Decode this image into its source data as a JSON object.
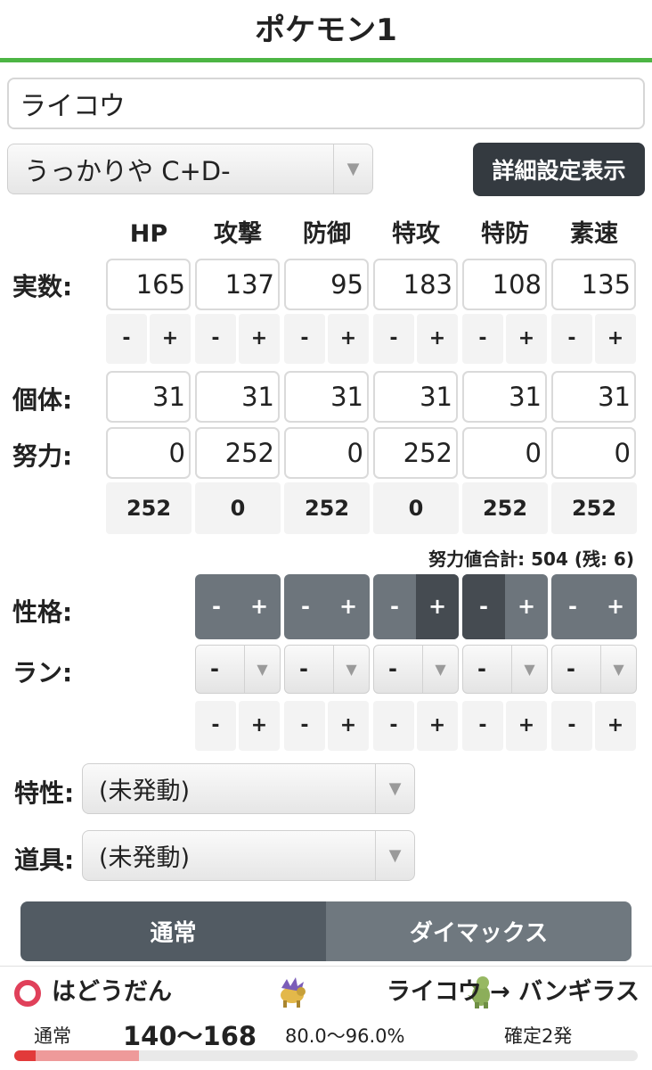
{
  "header": {
    "title": "ポケモン1"
  },
  "pokemon": {
    "name": "ライコウ"
  },
  "nature_select": {
    "value": "うっかりや C+D-"
  },
  "detail_button": {
    "label": "詳細設定表示"
  },
  "stats": {
    "headers": [
      "HP",
      "攻撃",
      "防御",
      "特攻",
      "特防",
      "素速"
    ],
    "labels": {
      "actual": "実数:",
      "iv": "個体:",
      "ev": "努力:",
      "nature": "性格:",
      "rank": "ラン:",
      "ability": "特性:",
      "item": "道具:"
    },
    "actual": [
      "165",
      "137",
      "95",
      "183",
      "108",
      "135"
    ],
    "iv": [
      "31",
      "31",
      "31",
      "31",
      "31",
      "31"
    ],
    "ev": [
      "0",
      "252",
      "0",
      "252",
      "0",
      "0"
    ],
    "ev_remaining": [
      "252",
      "0",
      "252",
      "0",
      "252",
      "252"
    ],
    "minus": "-",
    "plus": "+",
    "ev_total": "努力値合計: 504 (残: 6)",
    "nature_state": [
      "none",
      "none",
      "none",
      "plus",
      "minus",
      "none"
    ],
    "rank_values": [
      "-",
      "-",
      "-",
      "-",
      "-",
      "-"
    ]
  },
  "ability": {
    "value": "(未発動)"
  },
  "item": {
    "value": "(未発動)"
  },
  "mode_tabs": {
    "normal": "通常",
    "dynamax": "ダイマックス",
    "active": "normal"
  },
  "result": {
    "move": "はどうだん",
    "matchup": "ライコウ → バンギラス",
    "mode": "通常",
    "damage": "140〜168",
    "percent": "80.0〜96.0%",
    "ko": "確定2発",
    "damage_min_fraction": 0.2,
    "damage_max_fraction": 0.2,
    "colors": {
      "min": "#e23a3a",
      "range": "#ee9a9a",
      "move_icon": "#e0405a"
    }
  },
  "icons": {
    "arrow": "chevron-down-icon",
    "move": "fighting-type-icon",
    "attacker": "raikou-icon",
    "defender": "tyranitar-icon"
  }
}
